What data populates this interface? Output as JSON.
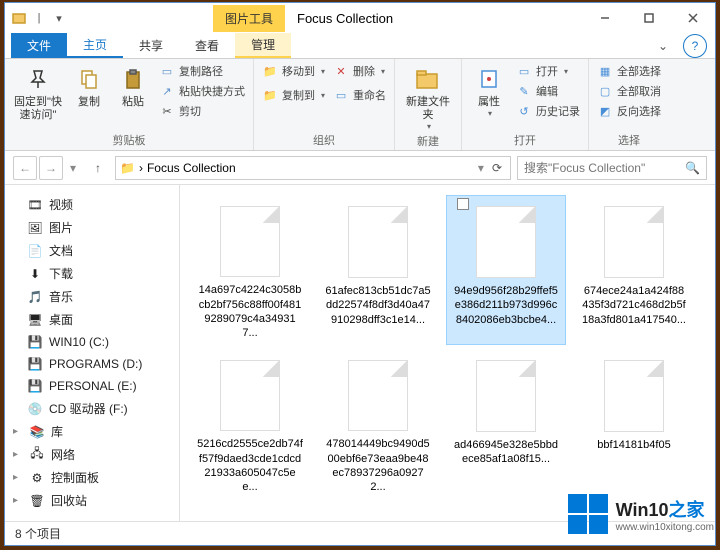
{
  "titlebar": {
    "context_tool_label": "图片工具",
    "title": "Focus Collection"
  },
  "tabs": {
    "file": "文件",
    "home": "主页",
    "share": "共享",
    "view": "查看",
    "manage": "管理"
  },
  "ribbon": {
    "clipboard": {
      "pin": "固定到\"快速访问\"",
      "copy": "复制",
      "paste": "粘贴",
      "copy_path": "复制路径",
      "paste_shortcut": "粘贴快捷方式",
      "cut": "剪切",
      "group": "剪贴板"
    },
    "organize": {
      "move_to": "移动到",
      "copy_to": "复制到",
      "delete": "删除",
      "rename": "重命名",
      "group": "组织"
    },
    "new": {
      "new_folder": "新建文件夹",
      "group": "新建"
    },
    "open": {
      "properties": "属性",
      "open": "打开",
      "edit": "编辑",
      "history": "历史记录",
      "group": "打开"
    },
    "select": {
      "select_all": "全部选择",
      "select_none": "全部取消",
      "invert": "反向选择",
      "group": "选择"
    }
  },
  "address": {
    "crumb_sep": "›",
    "crumb": "Focus Collection"
  },
  "search": {
    "placeholder": "搜索\"Focus Collection\""
  },
  "tree": [
    {
      "icon": "video",
      "label": "视频"
    },
    {
      "icon": "image",
      "label": "图片"
    },
    {
      "icon": "doc",
      "label": "文档"
    },
    {
      "icon": "download",
      "label": "下载"
    },
    {
      "icon": "music",
      "label": "音乐"
    },
    {
      "icon": "desktop",
      "label": "桌面"
    },
    {
      "icon": "drive",
      "label": "WIN10 (C:)"
    },
    {
      "icon": "drive",
      "label": "PROGRAMS (D:)"
    },
    {
      "icon": "drive",
      "label": "PERSONAL (E:)"
    },
    {
      "icon": "cd",
      "label": "CD 驱动器 (F:)"
    },
    {
      "icon": "lib",
      "label": "库",
      "lv0": true
    },
    {
      "icon": "net",
      "label": "网络",
      "lv0": true
    },
    {
      "icon": "ctrl",
      "label": "控制面板",
      "lv0": true
    },
    {
      "icon": "bin",
      "label": "回收站",
      "lv0": true
    }
  ],
  "files": [
    {
      "name": "14a697c4224c3058bcb2bf756c88ff00f4819289079c4a349317...",
      "selected": false
    },
    {
      "name": "61afec813cb51dc7a5dd22574f8df3d40a47910298dff3c1e14...",
      "selected": false
    },
    {
      "name": "94e9d956f28b29ffef5e386d211b973d996c8402086eb3bcbe4...",
      "selected": true
    },
    {
      "name": "674ece24a1a424f88435f3d721c468d2b5f18a3fd801a417540...",
      "selected": false
    },
    {
      "name": "5216cd2555ce2db74ff57f9daed3cde1cdcd21933a605047c5ee...",
      "selected": false
    },
    {
      "name": "478014449bc9490d500ebf6e73eaa9be48ec78937296a09272...",
      "selected": false
    },
    {
      "name": "ad466945e328e5bbdece85af1a08f15...",
      "selected": false
    },
    {
      "name": "bbf14181b4f05",
      "selected": false
    }
  ],
  "status": {
    "items": "8 个项目"
  },
  "watermark": {
    "line1a": "Win10",
    "line1b": "之家",
    "line2": "www.win10xitong.com"
  }
}
